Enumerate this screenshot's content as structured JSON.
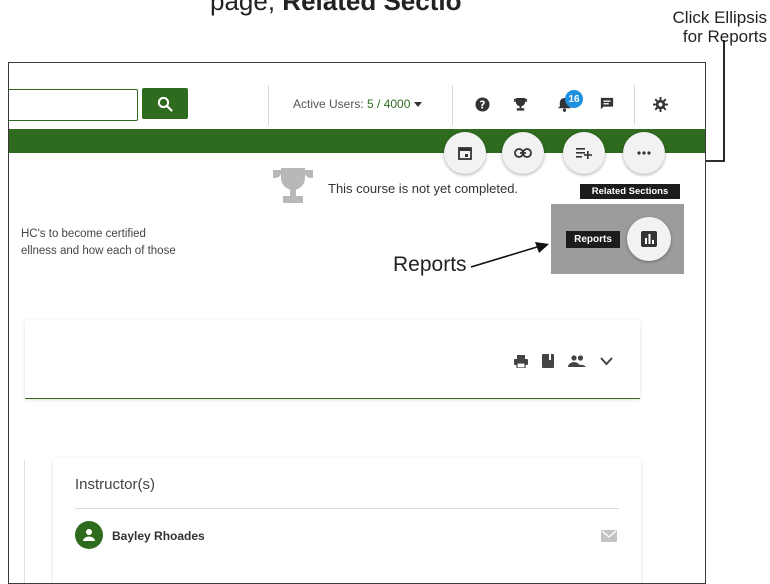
{
  "caption": {
    "pre": "page, ",
    "bold": "Related Sectio"
  },
  "callout": {
    "line1": "Click Ellipsis",
    "line2": "for Reports"
  },
  "header": {
    "search_placeholder": "",
    "active_users_label": "Active Users:",
    "active_users_count": "5 / 4000",
    "notifications_count": "16"
  },
  "fabs": [
    "calendar-icon",
    "link-icon",
    "add-to-list-icon",
    "ellipsis-icon"
  ],
  "related_sections_tooltip": "Related Sections",
  "course_status": "This course is not yet completed.",
  "description": {
    "line1": "HC's to become certified",
    "line2": "ellness and how each of those"
  },
  "reports_tooltip": "Reports",
  "reports_annotation": "Reports",
  "card_icons": [
    "print-icon",
    "book-icon",
    "group-icon",
    "chevron-down-icon"
  ],
  "instructors": {
    "title": "Instructor(s)",
    "items": [
      {
        "name": "Bayley Rhoades"
      }
    ]
  },
  "colors": {
    "brand_green": "#2e6b1f",
    "badge_blue": "#1e90e0",
    "highlight_gray": "#9c9c9c"
  }
}
